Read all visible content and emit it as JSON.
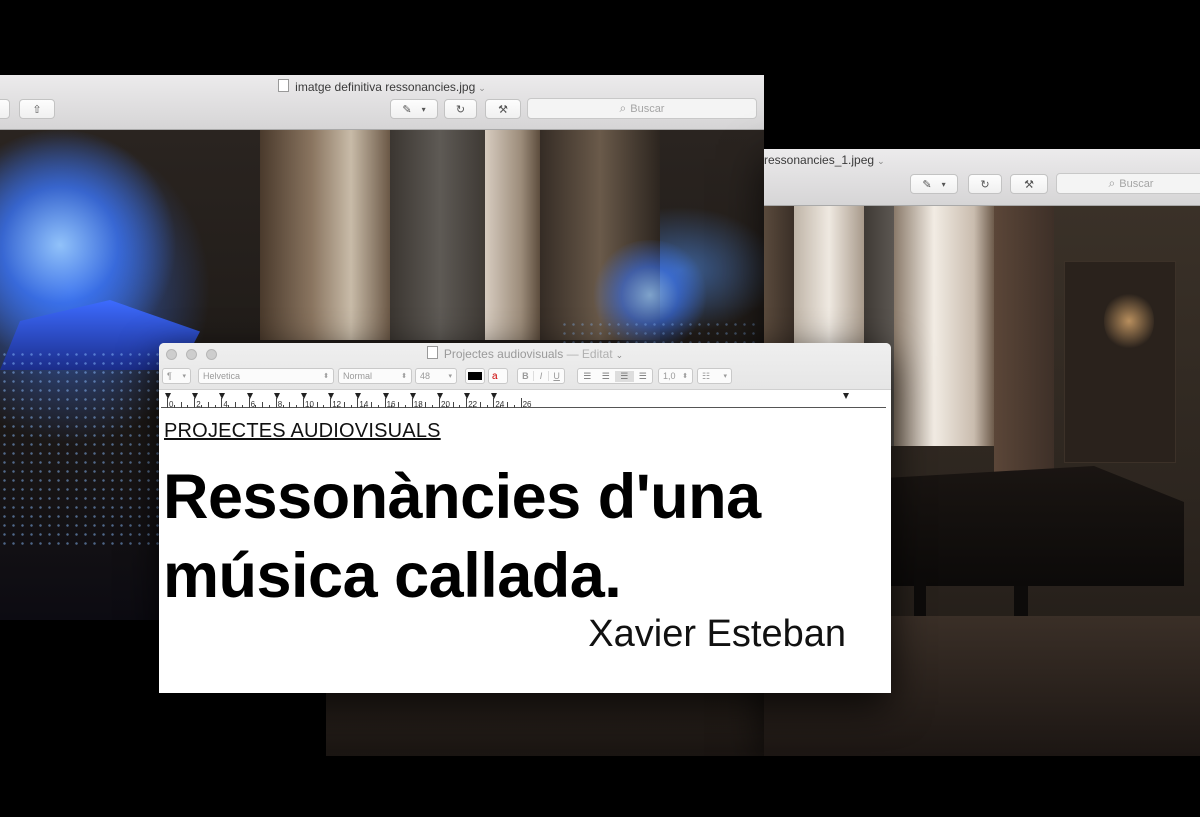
{
  "windows": {
    "left_preview": {
      "title": "imatge definitiva ressonancies.jpg",
      "search_placeholder": "Buscar"
    },
    "right_preview": {
      "title": "ressonancies_1.jpeg",
      "search_placeholder": "Buscar"
    }
  },
  "textedit": {
    "title": "Projectes audiovisuals",
    "title_status": "— Editat",
    "toolbar": {
      "paragraph_style": "¶",
      "font_family": "Helvetica",
      "font_style": "Normal",
      "font_size": "48",
      "bold": "B",
      "italic": "I",
      "underline": "U",
      "line_spacing": "1,0"
    },
    "ruler_numbers": [
      "0",
      "2",
      "4",
      "6",
      "8",
      "10",
      "12",
      "14",
      "16",
      "18",
      "20",
      "22",
      "24",
      "26"
    ],
    "document": {
      "kicker": "PROJECTES AUDIOVISUALS",
      "headline_line1": "Ressonàncies d'una",
      "headline_line2": "música callada.",
      "author": "Xavier Esteban"
    }
  },
  "colors": {
    "background": "#000000",
    "projection_blue": "#3c78ff",
    "titlebar": "#e2e2e2"
  }
}
